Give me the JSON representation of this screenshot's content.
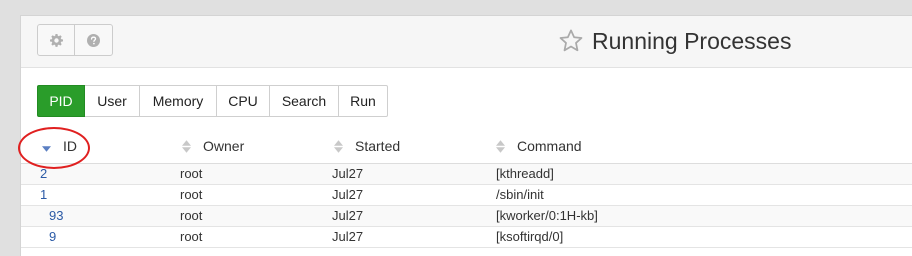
{
  "header": {
    "title": "Running Processes",
    "settings_icon": "gear-icon",
    "help_icon": "question-circle-icon",
    "favorite_icon": "star-outline-icon"
  },
  "tabs": [
    {
      "label": "PID",
      "active": true
    },
    {
      "label": "User",
      "active": false
    },
    {
      "label": "Memory",
      "active": false
    },
    {
      "label": "CPU",
      "active": false
    },
    {
      "label": "Search",
      "active": false
    },
    {
      "label": "Run",
      "active": false
    }
  ],
  "table": {
    "columns": [
      {
        "label": "ID",
        "sort": "descending"
      },
      {
        "label": "Owner",
        "sort": "none"
      },
      {
        "label": "Started",
        "sort": "none"
      },
      {
        "label": "Command",
        "sort": "none"
      }
    ],
    "rows": [
      {
        "id": "2",
        "owner": "root",
        "started": "Jul27",
        "command": "[kthreadd]"
      },
      {
        "id": "1",
        "owner": "root",
        "started": "Jul27",
        "command": "/sbin/init"
      },
      {
        "id": "93",
        "owner": "root",
        "started": "Jul27",
        "command": "[kworker/0:1H-kb]"
      },
      {
        "id": "9",
        "owner": "root",
        "started": "Jul27",
        "command": "[ksoftirqd/0]"
      }
    ]
  },
  "colors": {
    "active_tab": "#2a9d2a",
    "link": "#2b5aa6",
    "annotation": "#e02020",
    "sort_active": "#5b7fc2"
  }
}
